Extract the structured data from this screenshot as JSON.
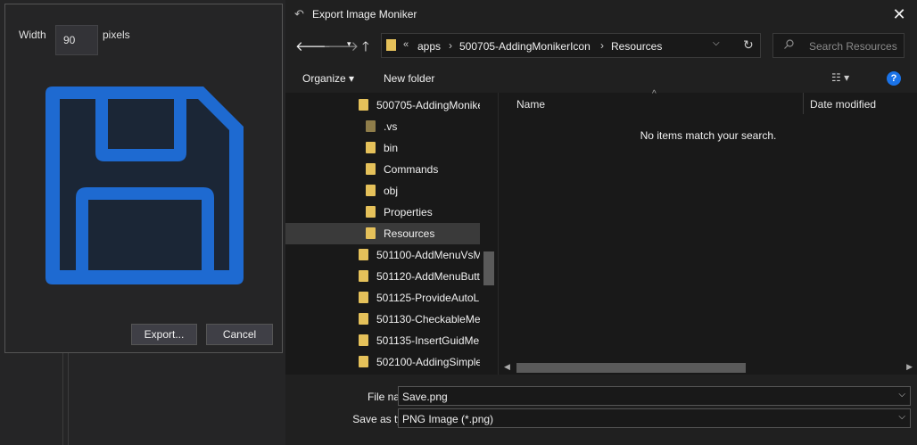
{
  "panel": {
    "width_label": "Width",
    "width_value": "90",
    "pixels_label": "pixels",
    "preview_icon": "floppy-disk-save-icon",
    "export_label": "Export...",
    "cancel_label": "Cancel"
  },
  "dialog": {
    "title": "Export Image Moniker",
    "close_glyph": "✕",
    "nav": {
      "back": "🡐",
      "forward": "🡒",
      "recent": "▾",
      "up": "🡑"
    },
    "address": {
      "overflow": "«",
      "crumbs": [
        "apps",
        "500705-AddingMonikerIcon",
        "Resources"
      ],
      "separator": "›",
      "dropdown": "⌵",
      "refresh": "↻"
    },
    "search_placeholder": "Search Resources",
    "toolbar": {
      "organize": "Organize ▾",
      "new_folder": "New folder",
      "views": "☷ ▾",
      "help": "?"
    },
    "tree": [
      {
        "label": "500705-AddingMonike",
        "indent": 1,
        "selected": false,
        "dim": false
      },
      {
        "label": ".vs",
        "indent": 2,
        "selected": false,
        "dim": true
      },
      {
        "label": "bin",
        "indent": 2,
        "selected": false,
        "dim": false
      },
      {
        "label": "Commands",
        "indent": 2,
        "selected": false,
        "dim": false
      },
      {
        "label": "obj",
        "indent": 2,
        "selected": false,
        "dim": false
      },
      {
        "label": "Properties",
        "indent": 2,
        "selected": false,
        "dim": false
      },
      {
        "label": "Resources",
        "indent": 2,
        "selected": true,
        "dim": false
      },
      {
        "label": "501100-AddMenuVsM",
        "indent": 1,
        "selected": false,
        "dim": false
      },
      {
        "label": "501120-AddMenuButt",
        "indent": 1,
        "selected": false,
        "dim": false
      },
      {
        "label": "501125-ProvideAutoL",
        "indent": 1,
        "selected": false,
        "dim": false
      },
      {
        "label": "501130-CheckableMe",
        "indent": 1,
        "selected": false,
        "dim": false
      },
      {
        "label": "501135-InsertGuidMe",
        "indent": 1,
        "selected": false,
        "dim": false
      },
      {
        "label": "502100-AddingSimple",
        "indent": 1,
        "selected": false,
        "dim": false
      }
    ],
    "columns": {
      "name": "Name",
      "date_modified": "Date modified",
      "sort_arrow": "^"
    },
    "empty_message": "No items match your search.",
    "file_name_label": "File name:",
    "file_name_value": "Save.png",
    "save_as_type_label": "Save as type:",
    "save_as_type_value": "PNG Image (*.png)",
    "dropdown_chevron": "⌵"
  },
  "colors": {
    "accent_blue": "#1e6ad1",
    "folder_yellow": "#e5c15a"
  }
}
